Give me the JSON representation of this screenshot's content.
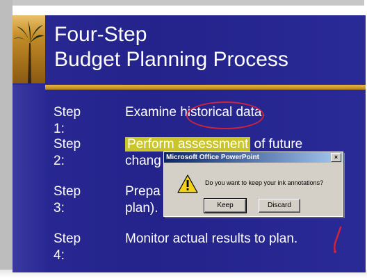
{
  "slide": {
    "title_line1": "Four-Step",
    "title_line2": "Budget Planning Process",
    "steps": [
      {
        "label": "Step 1:",
        "text_before": "Examine ",
        "text_circled": "historical",
        "text_after": " data."
      },
      {
        "label": "Step 2:",
        "text_highlight": "Perform assessment",
        "text_after": " of future",
        "line2": "chang"
      },
      {
        "label": "Step 3:",
        "text": "Prepa",
        "line2": "plan)."
      },
      {
        "label": "Step 4:",
        "text": "Monitor actual results to plan."
      }
    ]
  },
  "dialog": {
    "title": "Microsoft Office PowerPoint",
    "close_glyph": "×",
    "icon": "warning-icon",
    "message": "Do you want to keep your ink annotations?",
    "keep_label": "Keep",
    "discard_label": "Discard"
  },
  "colors": {
    "slide_bg": "#25238c",
    "accent_gold": "#d9a63a",
    "highlight": "#c9c52a",
    "ink": "#d0233a"
  }
}
